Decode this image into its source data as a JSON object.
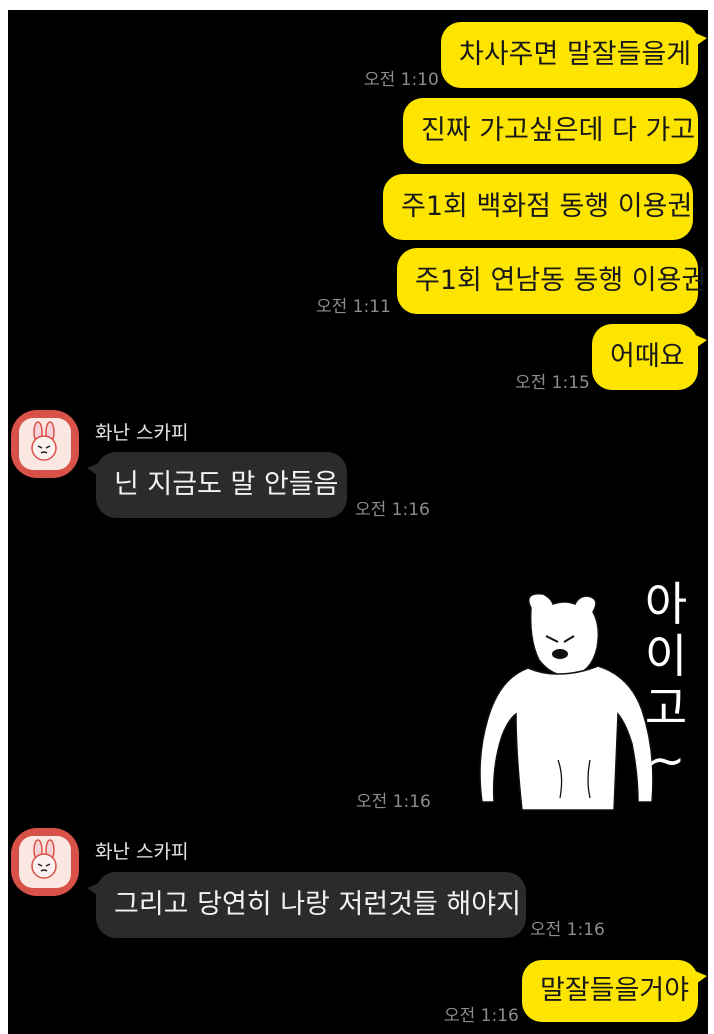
{
  "messages": {
    "m1": {
      "text": "차사주면 말잘들을게",
      "time": "오전 1:10"
    },
    "m2": {
      "text": "진짜 가고싶은데 다 가고"
    },
    "m3": {
      "text": "주1회 백화점 동행 이용권"
    },
    "m4": {
      "text": "주1회 연남동 동행 이용권",
      "time": "오전 1:11"
    },
    "m5": {
      "text": "어때요",
      "time": "오전 1:15"
    },
    "m6": {
      "sender": "화난 스카피",
      "text": "닌 지금도 말 안들음",
      "time": "오전 1:16"
    },
    "m7": {
      "sticker_text": [
        "아",
        "이",
        "고",
        "~"
      ],
      "time": "오전 1:16"
    },
    "m8": {
      "sender": "화난 스카피",
      "text": "그리고 당연히 나랑 저런것들 해야지",
      "time": "오전 1:16"
    },
    "m9": {
      "text": "말잘들을거야",
      "time": "오전 1:16"
    }
  },
  "colors": {
    "background": "#000000",
    "my_bubble": "#fee500",
    "their_bubble": "#2b2b2b",
    "timestamp": "#8c8c8c",
    "avatar": "#d9524a"
  }
}
